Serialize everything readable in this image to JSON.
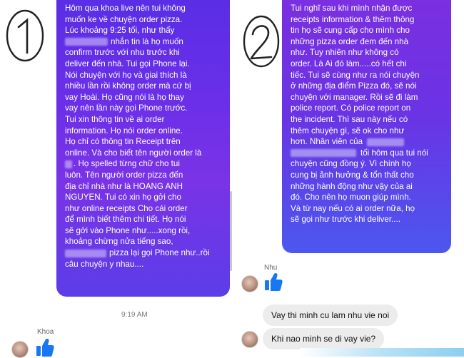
{
  "annotations": {
    "left_marker": "①",
    "right_marker": "②"
  },
  "colors": {
    "bubble_left_top": "#5a2ee6",
    "bubble_right_top": "#7a2fe0",
    "bubble_right_bottom": "#4c57ef",
    "like_blue": "#1877f2",
    "gray_bubble": "#ececec"
  },
  "left_message": {
    "lines": [
      "Hôm qua khoa live nên tui không",
      "muốn ke về chuyện order pizza.",
      "Lúc khoảng 9:25 tối, như thấy",
      "nhắn tin là họ muốn",
      "confirm trước với nhu trước khi",
      "deliver đến nhà. Tui gọi Phone lại.",
      "Nói chuyện với họ và giai thích là",
      "nhiều lần rồi không order mà cứ bị",
      "vay Hoài. Họ cũng nói là họ thay",
      "vay nên lần này gọi Phone trước.",
      "Tui xin thông tin về ai order",
      "information. Họ nói order online.",
      "Họ chỉ có thông tin Receipt trên",
      "online. Và cho biết tên người order là",
      ". Họ spelled từng chữ cho tui",
      "luôn. Tên người order pizza đến",
      "địa chỉ nhà như là HOANG ANH",
      "NGUYEN. Tui có xin họ gởi cho",
      "như online receipts Cho cái order",
      "để mình biết thêm chi tiết. Họ nói",
      "sẽ gởi vào Phone như.....xong rồi,",
      "khoảng chừng nửa tiếng sao,",
      "pizza lại gọi Phone như..rồi",
      "câu chuyện y nhau...."
    ],
    "time": "9:19 AM",
    "sender": "Khoa"
  },
  "right_message": {
    "lines": [
      "Tui nghĩ sau khi mình nhận được",
      "receipts information & thêm thông",
      "tin họ sẽ cung cấp cho mình cho",
      "những pizza order đem đến nhà",
      "như. Tuy nhiên như không có",
      "order. Là Ai đó làm.....có hết chi",
      "tiếc. Tui sẽ cùng như ra nói chuyện",
      "ở những địa điểm Pizza đó, sẽ nói",
      "chuyện với manager. Rồi sẽ đi làm",
      "police report. Có police report on",
      "the incident. Thì sau này nếu có",
      "thêm chuyện gì, sẽ ok cho như",
      "hơn. Nhân viên của",
      "tối hôm qua tui nói",
      "chuyện cũng đồng ý. Vì chính họ",
      "cung bị ảnh hưởng & tổn thất cho",
      "những hành động như vậy của ai",
      "đó. Cho nên họ muon giúp mình.",
      "Và từ nay nếu có ai order nữa, họ",
      "sẽ gọi như trước khi deliver...."
    ]
  },
  "reply": {
    "sender": "Nhu",
    "messages": [
      "Vay thi minh cu lam nhu vie noi",
      "Khi nao minh se di vay vie?"
    ]
  }
}
